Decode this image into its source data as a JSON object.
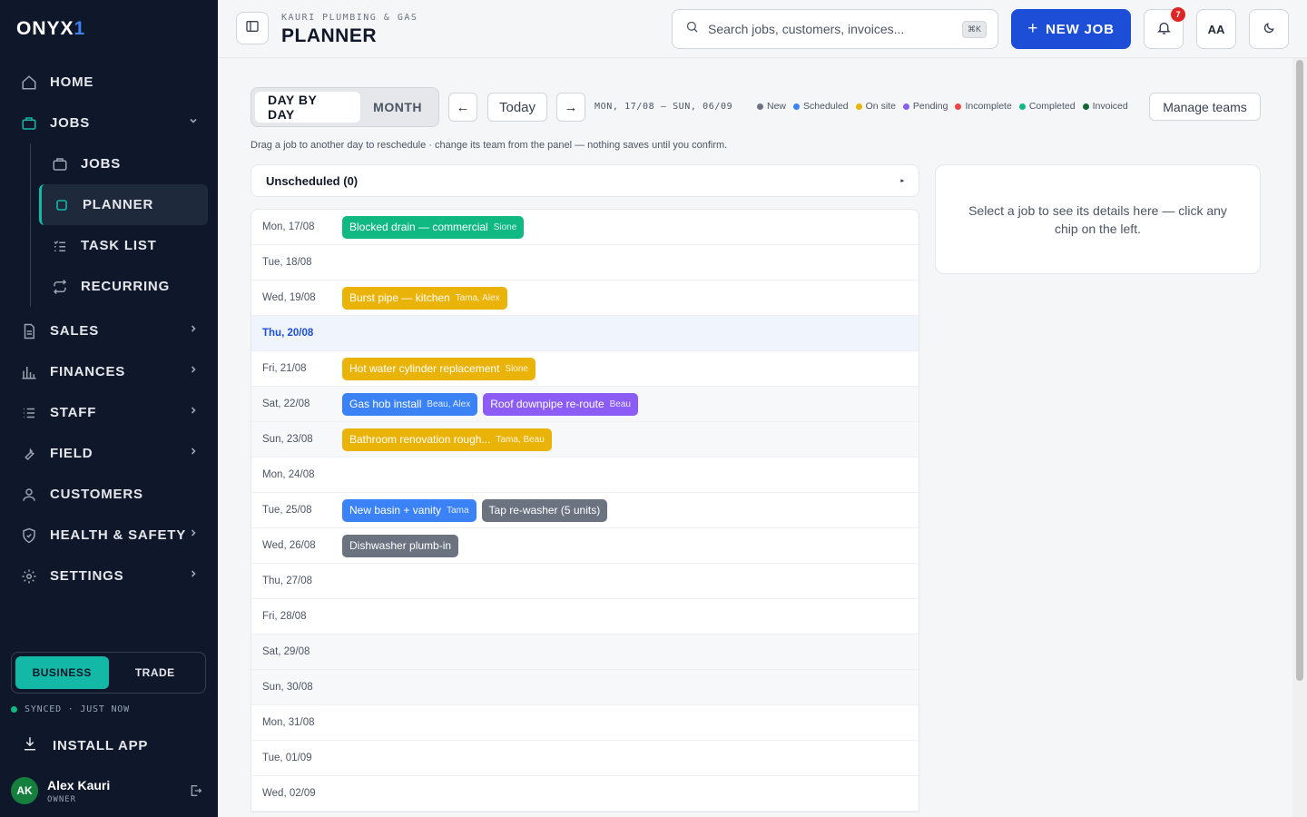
{
  "brand": {
    "name": "ONYX",
    "mark": "1"
  },
  "nav": {
    "items": [
      {
        "label": "HOME",
        "icon": "home-icon"
      },
      {
        "label": "JOBS",
        "icon": "briefcase-icon"
      },
      {
        "label": "SALES",
        "icon": "document-icon"
      },
      {
        "label": "FINANCES",
        "icon": "bar-chart-icon"
      },
      {
        "label": "STAFF",
        "icon": "list-icon"
      },
      {
        "label": "FIELD",
        "icon": "wrench-icon"
      },
      {
        "label": "CUSTOMERS",
        "icon": "user-icon"
      },
      {
        "label": "HEALTH & SAFETY",
        "icon": "shield-icon"
      },
      {
        "label": "SETTINGS",
        "icon": "gear-icon"
      }
    ],
    "jobs_sub": [
      {
        "label": "JOBS"
      },
      {
        "label": "PLANNER"
      },
      {
        "label": "TASK LIST"
      },
      {
        "label": "RECURRING"
      }
    ]
  },
  "mode": {
    "business": "BUSINESS",
    "trade": "TRADE"
  },
  "sync": {
    "text": "SYNCED · JUST NOW"
  },
  "install": "INSTALL APP",
  "user": {
    "initials": "AK",
    "name": "Alex Kauri",
    "role": "OWNER"
  },
  "header": {
    "company": "KAURI PLUMBING & GAS",
    "title": "PLANNER"
  },
  "search": {
    "placeholder": "Search jobs, customers, invoices...",
    "shortcut": "⌘K"
  },
  "new_job": "NEW JOB",
  "notifications": {
    "count": "7"
  },
  "font_toggle": "AA",
  "view": {
    "day": "DAY BY DAY",
    "month": "MONTH"
  },
  "nav_buttons": {
    "prev": "←",
    "today": "Today",
    "next": "→"
  },
  "range": "MON, 17/08 — SUN, 06/09",
  "legend": [
    {
      "label": "New",
      "color": "#6b7280"
    },
    {
      "label": "Scheduled",
      "color": "#3b82f6"
    },
    {
      "label": "On site",
      "color": "#eab308"
    },
    {
      "label": "Pending",
      "color": "#8b5cf6"
    },
    {
      "label": "Incomplete",
      "color": "#ef4444"
    },
    {
      "label": "Completed",
      "color": "#10b981"
    },
    {
      "label": "Invoiced",
      "color": "#166534"
    }
  ],
  "manage_teams": "Manage teams",
  "hint": "Drag a job to another day to reschedule · change its team from the panel — nothing saves until you confirm.",
  "unscheduled": "Unscheduled (0)",
  "detail_empty": "Select a job to see its details here — click any chip on the left.",
  "days": [
    {
      "label": "Mon, 17/08",
      "type": "",
      "jobs": [
        {
          "title": "Blocked drain — commercial",
          "who": "Sione",
          "color": "#10b981"
        }
      ]
    },
    {
      "label": "Tue, 18/08",
      "type": "",
      "jobs": []
    },
    {
      "label": "Wed, 19/08",
      "type": "",
      "jobs": [
        {
          "title": "Burst pipe — kitchen",
          "who": "Tama, Alex",
          "color": "#eab308"
        }
      ]
    },
    {
      "label": "Thu, 20/08",
      "type": "today",
      "jobs": []
    },
    {
      "label": "Fri, 21/08",
      "type": "",
      "jobs": [
        {
          "title": "Hot water cylinder replacement",
          "who": "Sione",
          "color": "#eab308"
        }
      ]
    },
    {
      "label": "Sat, 22/08",
      "type": "weekend",
      "jobs": [
        {
          "title": "Gas hob install",
          "who": "Beau, Alex",
          "color": "#3b82f6"
        },
        {
          "title": "Roof downpipe re-route",
          "who": "Beau",
          "color": "#8b5cf6"
        }
      ]
    },
    {
      "label": "Sun, 23/08",
      "type": "weekend",
      "jobs": [
        {
          "title": "Bathroom renovation rough...",
          "who": "Tama, Beau",
          "color": "#eab308"
        }
      ]
    },
    {
      "label": "Mon, 24/08",
      "type": "",
      "jobs": []
    },
    {
      "label": "Tue, 25/08",
      "type": "",
      "jobs": [
        {
          "title": "New basin + vanity",
          "who": "Tama",
          "color": "#3b82f6"
        },
        {
          "title": "Tap re-washer (5 units)",
          "who": "",
          "color": "#6b7280"
        }
      ]
    },
    {
      "label": "Wed, 26/08",
      "type": "",
      "jobs": [
        {
          "title": "Dishwasher plumb-in",
          "who": "",
          "color": "#6b7280"
        }
      ]
    },
    {
      "label": "Thu, 27/08",
      "type": "",
      "jobs": []
    },
    {
      "label": "Fri, 28/08",
      "type": "",
      "jobs": []
    },
    {
      "label": "Sat, 29/08",
      "type": "weekend",
      "jobs": []
    },
    {
      "label": "Sun, 30/08",
      "type": "weekend",
      "jobs": []
    },
    {
      "label": "Mon, 31/08",
      "type": "",
      "jobs": []
    },
    {
      "label": "Tue, 01/09",
      "type": "",
      "jobs": []
    },
    {
      "label": "Wed, 02/09",
      "type": "",
      "jobs": []
    }
  ]
}
